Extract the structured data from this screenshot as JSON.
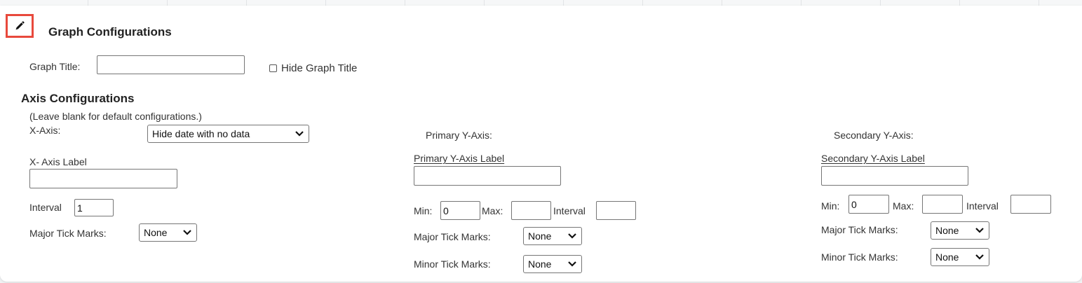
{
  "graph": {
    "heading": "Graph Configurations",
    "title_label": "Graph Title:",
    "title_value": "",
    "hide_title_label": "Hide Graph Title",
    "hide_title_checked": false
  },
  "axis": {
    "heading": "Axis Configurations",
    "note": "(Leave blank for default configurations.)",
    "x": {
      "heading": "X-Axis:",
      "select_value": "Hide date with no data",
      "label_heading": "X- Axis Label",
      "label_value": "",
      "interval_label": "Interval",
      "interval_value": "1",
      "major_label": "Major Tick Marks:",
      "major_value": "None"
    },
    "primary_y": {
      "heading": "Primary Y-Axis:",
      "label_heading": "Primary Y-Axis Label",
      "label_value": "",
      "min_label": "Min:",
      "min_value": "0",
      "max_label": "Max:",
      "max_value": "",
      "interval_label": "Interval",
      "interval_value": "",
      "major_label": "Major Tick Marks:",
      "major_value": "None",
      "minor_label": "Minor Tick Marks:",
      "minor_value": "None"
    },
    "secondary_y": {
      "heading": "Secondary Y-Axis:",
      "label_heading": "Secondary Y-Axis Label",
      "label_value": "",
      "min_label": "Min:",
      "min_value": "0",
      "max_label": "Max:",
      "max_value": "",
      "interval_label": "Interval",
      "interval_value": "",
      "major_label": "Major Tick Marks:",
      "major_value": "None",
      "minor_label": "Minor Tick Marks:",
      "minor_value": "None"
    }
  },
  "colors": {
    "highlight": "#e8493c"
  }
}
